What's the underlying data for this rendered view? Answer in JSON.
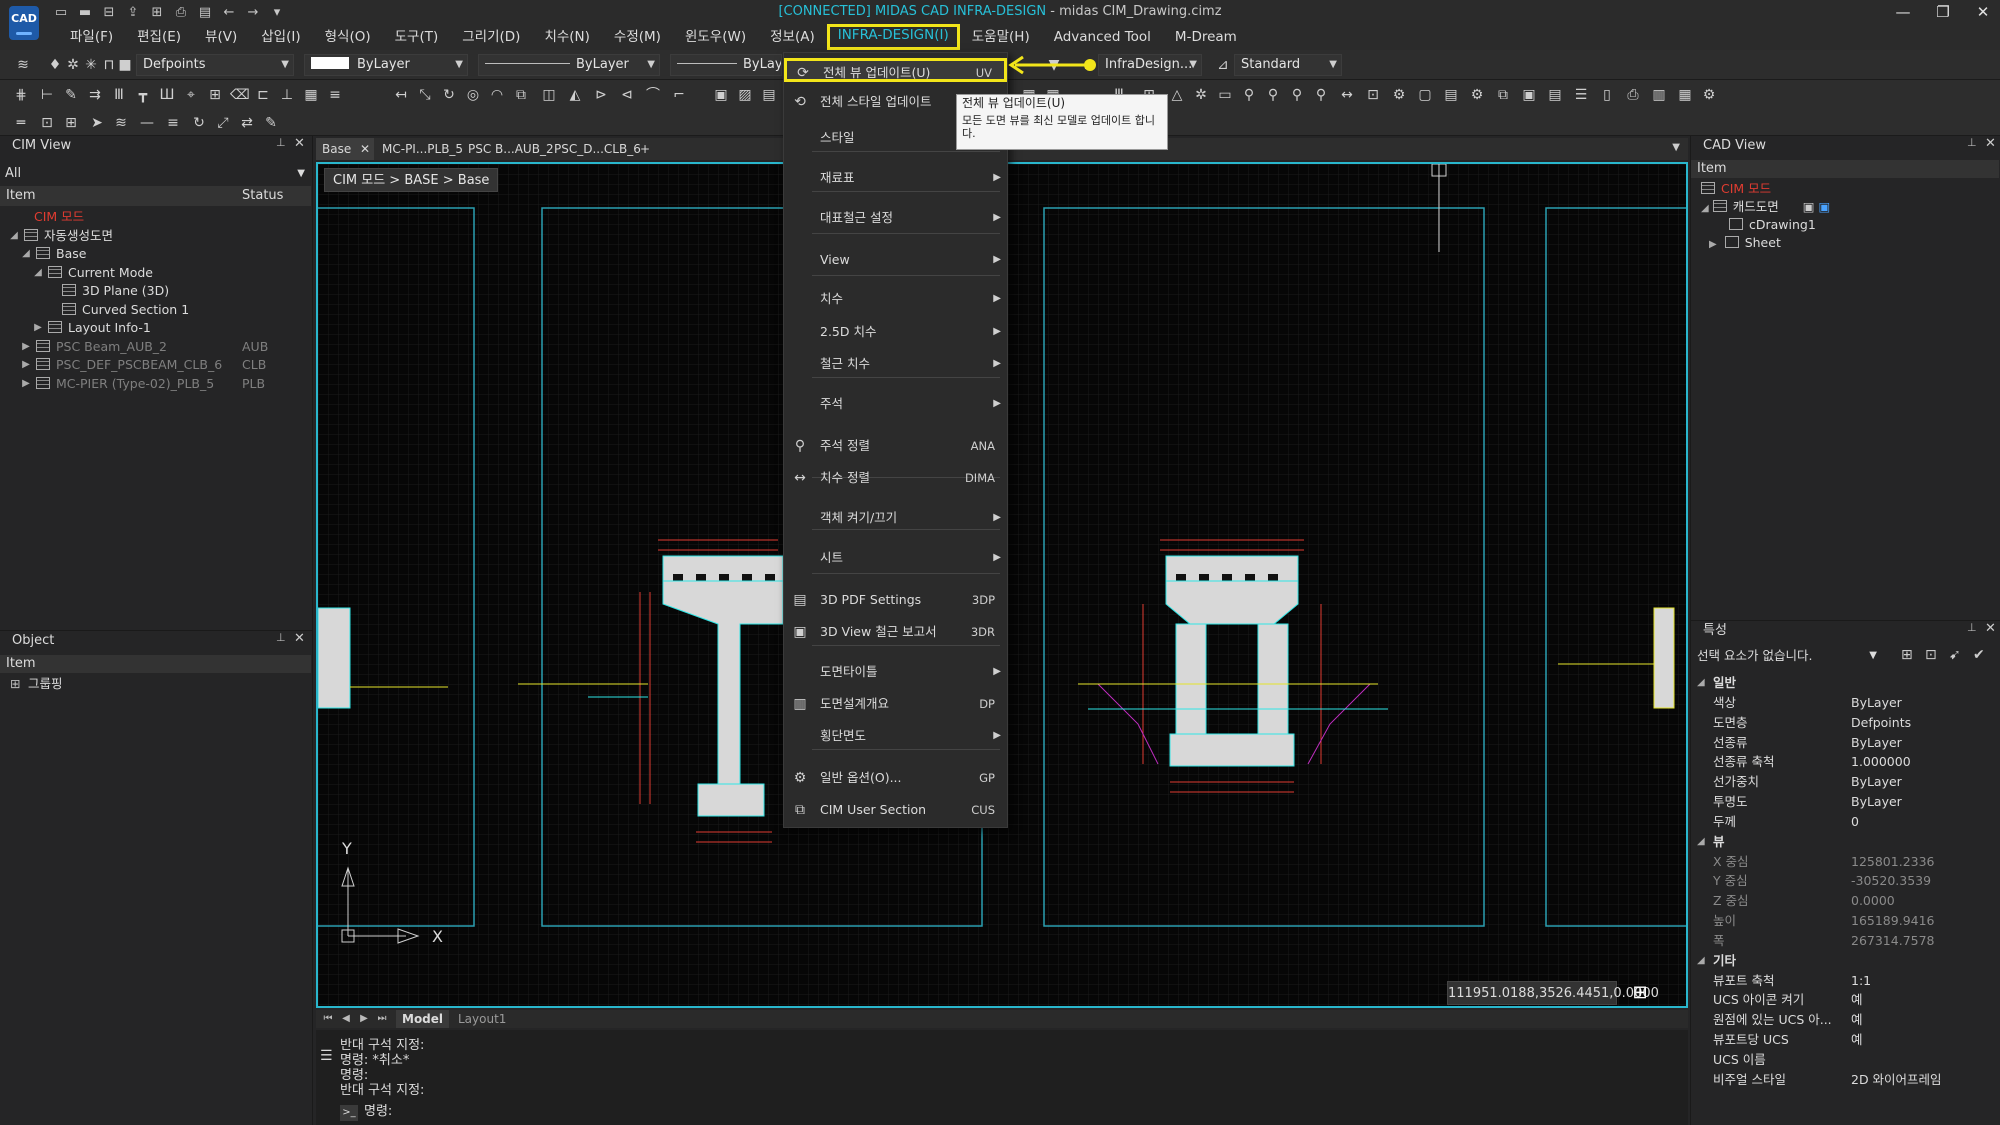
{
  "window": {
    "title_connected": "[CONNECTED] MIDAS CAD INFRA-DESIGN",
    "title_rest": " - midas CIM_Drawing.cimz",
    "logo": "CAD",
    "minimize": "—",
    "maximize": "❐",
    "close": "✕"
  },
  "menubar": {
    "items": [
      "파일(F)",
      "편집(E)",
      "뷰(V)",
      "삽입(I)",
      "형식(O)",
      "도구(T)",
      "그리기(D)",
      "치수(N)",
      "수정(M)",
      "윈도우(W)",
      "정보(A)",
      "INFRA-DESIGN(I)",
      "도움말(H)",
      "Advanced Tool",
      "M-Dream"
    ],
    "active": "INFRA-DESIGN(I)"
  },
  "toolbar": {
    "layer_value": "Defpoints",
    "color_value": "ByLayer",
    "linetype_value": "ByLayer",
    "lineweight_value": "ByLay",
    "dimstyle_value": "InfraDesign...",
    "textstyle_value": "Standard"
  },
  "cim_view": {
    "title": "CIM View",
    "filter": "All",
    "col_item": "Item",
    "col_status": "Status",
    "tree": [
      {
        "label": "CIM 모드",
        "status": "",
        "style": "red"
      },
      {
        "label": "자동생성도면",
        "status": "",
        "style": "normal"
      },
      {
        "label": "Base",
        "status": "",
        "style": "normal"
      },
      {
        "label": "Current Mode",
        "status": "",
        "style": "normal"
      },
      {
        "label": "3D Plane (3D)",
        "status": "",
        "style": "normal"
      },
      {
        "label": "Curved Section 1",
        "status": "",
        "style": "normal"
      },
      {
        "label": "Layout Info-1",
        "status": "",
        "style": "normal"
      },
      {
        "label": "PSC Beam_AUB_2",
        "status": "AUB",
        "style": "dim"
      },
      {
        "label": "PSC_DEF_PSCBEAM_CLB_6",
        "status": "CLB",
        "style": "dim"
      },
      {
        "label": "MC-PIER (Type-02)_PLB_5",
        "status": "PLB",
        "style": "dim"
      }
    ]
  },
  "object_panel": {
    "title": "Object",
    "col_item": "Item",
    "row": "그룹핑"
  },
  "doc_tabs": [
    "Base",
    "MC-PI...PLB_5",
    "PSC B...AUB_2",
    "PSC_D...CLB_6"
  ],
  "doc_tab_add": "+",
  "canvas": {
    "breadcrumb": "CIM 모드 > BASE > Base",
    "coords": "111951.0188,3526.4451,0.0000",
    "axis_x": "X",
    "axis_y": "Y"
  },
  "layout_tabs": {
    "model": "Model",
    "layout1": "Layout1"
  },
  "command": {
    "lines": [
      "반대 구석 지정:",
      "명령: *취소*",
      "명령:",
      "반대 구석 지정:"
    ],
    "prompt": "명령:"
  },
  "dropdown": {
    "items": [
      {
        "label": "전체 뷰 업데이트(U)",
        "shortcut": "UV",
        "icon": "view-update-icon",
        "sub": false
      },
      {
        "label": "전체 스타일 업데이트",
        "shortcut": "",
        "icon": "style-update-icon",
        "sub": false
      },
      {
        "label": "스타일",
        "shortcut": "",
        "icon": "",
        "sub": true
      },
      {
        "label": "재료표",
        "shortcut": "",
        "icon": "",
        "sub": true
      },
      {
        "label": "대표철근 설정",
        "shortcut": "",
        "icon": "",
        "sub": true
      },
      {
        "label": "View",
        "shortcut": "",
        "icon": "",
        "sub": true
      },
      {
        "label": "치수",
        "shortcut": "",
        "icon": "",
        "sub": true
      },
      {
        "label": "2.5D 치수",
        "shortcut": "",
        "icon": "",
        "sub": true
      },
      {
        "label": "철근 치수",
        "shortcut": "",
        "icon": "",
        "sub": true
      },
      {
        "label": "주석",
        "shortcut": "",
        "icon": "",
        "sub": true
      },
      {
        "label": "주석 정렬",
        "shortcut": "ANA",
        "icon": "annotation-align-icon",
        "sub": false
      },
      {
        "label": "치수 정렬",
        "shortcut": "DIMA",
        "icon": "dimension-align-icon",
        "sub": false
      },
      {
        "label": "객체 켜기/끄기",
        "shortcut": "",
        "icon": "",
        "sub": true
      },
      {
        "label": "시트",
        "shortcut": "",
        "icon": "",
        "sub": true
      },
      {
        "label": "3D PDF Settings",
        "shortcut": "3DP",
        "icon": "pdf-icon",
        "sub": false
      },
      {
        "label": "3D View 철근 보고서",
        "shortcut": "3DR",
        "icon": "report-icon",
        "sub": false
      },
      {
        "label": "도면타이틀",
        "shortcut": "",
        "icon": "",
        "sub": true
      },
      {
        "label": "도면설계개요",
        "shortcut": "DP",
        "icon": "overview-icon",
        "sub": false
      },
      {
        "label": "횡단면도",
        "shortcut": "",
        "icon": "",
        "sub": true
      },
      {
        "label": "일반 옵션(O)...",
        "shortcut": "GP",
        "icon": "gear-icon",
        "sub": false
      },
      {
        "label": "CIM User Section",
        "shortcut": "CUS",
        "icon": "section-icon",
        "sub": false
      }
    ]
  },
  "tooltip": {
    "title": "전체 뷰 업데이트(U)",
    "body": "모든 도면 뷰를 최신 모델로 업데이트 합니다."
  },
  "cad_view": {
    "title": "CAD View",
    "col_item": "Item",
    "tree": [
      "CIM 모드",
      "캐드도면",
      "cDrawing1",
      "Sheet"
    ]
  },
  "properties": {
    "title": "특성",
    "selection": "선택 요소가 없습니다.",
    "categories": {
      "general": "일반",
      "view": "뷰",
      "misc": "기타"
    },
    "general": [
      {
        "name": "색상",
        "value": "ByLayer"
      },
      {
        "name": "도면층",
        "value": "Defpoints"
      },
      {
        "name": "선종류",
        "value": "ByLayer"
      },
      {
        "name": "선종류 축척",
        "value": "1.000000"
      },
      {
        "name": "선가중치",
        "value": "ByLayer"
      },
      {
        "name": "투명도",
        "value": "ByLayer"
      },
      {
        "name": "두께",
        "value": "0"
      }
    ],
    "view": [
      {
        "name": "X 중심",
        "value": "125801.2336"
      },
      {
        "name": "Y 중심",
        "value": "-30520.3539"
      },
      {
        "name": "Z 중심",
        "value": "0.0000"
      },
      {
        "name": "높이",
        "value": "165189.9416"
      },
      {
        "name": "폭",
        "value": "267314.7578"
      }
    ],
    "misc": [
      {
        "name": "뷰포트 축척",
        "value": "1:1"
      },
      {
        "name": "UCS 아이콘 켜기",
        "value": "예"
      },
      {
        "name": "원점에 있는 UCS 아...",
        "value": "예"
      },
      {
        "name": "뷰포트당 UCS",
        "value": "예"
      },
      {
        "name": "UCS 이름",
        "value": ""
      },
      {
        "name": "비주얼 스타일",
        "value": "2D 와이어프레임"
      }
    ]
  },
  "colors": {
    "accent_cyan": "#27c0d8",
    "highlight_yellow": "#f2e51a",
    "mode_red": "#e03c31"
  }
}
